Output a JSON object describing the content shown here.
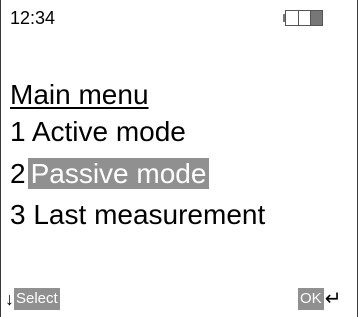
{
  "status_bar": {
    "time": "12:34",
    "battery_level_fraction": 0.33,
    "battery_icon": "battery-icon"
  },
  "menu": {
    "title": "Main menu",
    "items": [
      {
        "number": "1",
        "label": "Active mode",
        "selected": false
      },
      {
        "number": "2",
        "label": "Passive mode",
        "selected": true
      },
      {
        "number": "3",
        "label": "Last measurement",
        "selected": false
      }
    ]
  },
  "softkeys": {
    "left_label": "Select",
    "left_icon": "down-arrow-icon",
    "right_label": "OK",
    "right_icon": "enter-icon"
  },
  "colors": {
    "highlight": "#909090",
    "highlight_text": "#ffffff",
    "text": "#000000",
    "background": "#ffffff"
  }
}
